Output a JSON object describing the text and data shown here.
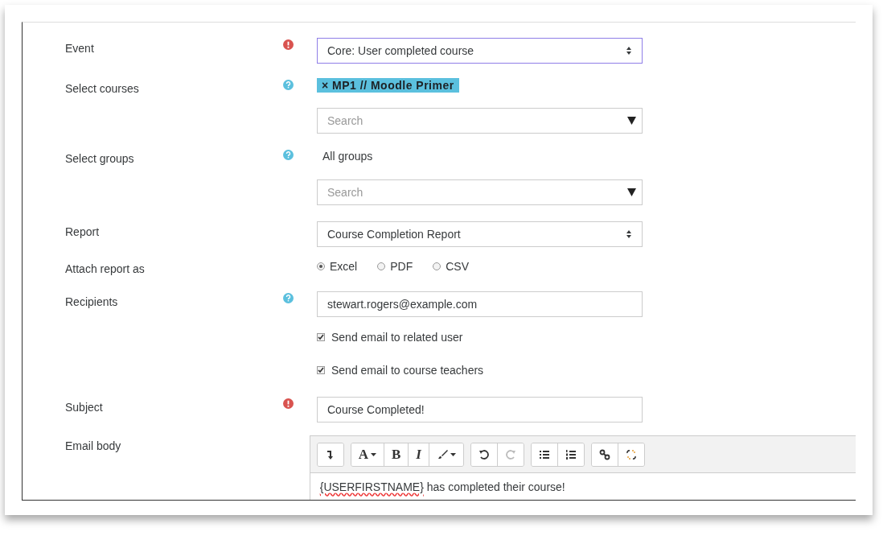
{
  "fields": [
    {
      "kind": "select",
      "label": "Event",
      "required": true,
      "value": "Core: User completed course",
      "focused": true
    },
    {
      "kind": "autocomplete",
      "label": "Select courses",
      "help": true,
      "tags": [
        {
          "remove": "×",
          "label": "MP1 // Moodle Primer"
        }
      ],
      "placeholder": "Search"
    },
    {
      "kind": "autocomplete",
      "label": "Select groups",
      "help": true,
      "value": "All groups",
      "placeholder": "Search"
    },
    {
      "kind": "select",
      "label": "Report",
      "value": "Course Completion Report",
      "focused": false
    },
    {
      "kind": "radios",
      "label": "Attach report as",
      "options": [
        {
          "label": "Excel",
          "selected": true
        },
        {
          "label": "PDF",
          "selected": false
        },
        {
          "label": "CSV",
          "selected": false
        }
      ]
    },
    {
      "kind": "recipients",
      "label": "Recipients",
      "help": true,
      "value": "stewart.rogers@example.com",
      "checkboxes": [
        {
          "label": "Send email to related user",
          "checked": true
        },
        {
          "label": "Send email to course teachers",
          "checked": true
        }
      ]
    },
    {
      "kind": "text",
      "label": "Subject",
      "required": true,
      "value": "Course Completed!"
    },
    {
      "kind": "editor",
      "label": "Email body",
      "toolbar": [
        [
          {
            "kind": "insert",
            "disabled": false
          }
        ],
        [
          {
            "kind": "font",
            "label": "A",
            "disabled": false
          },
          {
            "kind": "bold",
            "label": "B",
            "disabled": false
          },
          {
            "kind": "italic",
            "label": "I",
            "disabled": false
          },
          {
            "kind": "brush",
            "disabled": false
          }
        ],
        [
          {
            "kind": "undo",
            "disabled": false
          },
          {
            "kind": "redo",
            "disabled": true
          }
        ],
        [
          {
            "kind": "bullets",
            "disabled": false
          },
          {
            "kind": "numbers",
            "disabled": false
          }
        ],
        [
          {
            "kind": "link",
            "disabled": false
          },
          {
            "kind": "unlink",
            "disabled": false
          }
        ]
      ],
      "content_placeholder": "{USERFIRSTNAME}",
      "content_rest": " has completed their course!"
    }
  ]
}
